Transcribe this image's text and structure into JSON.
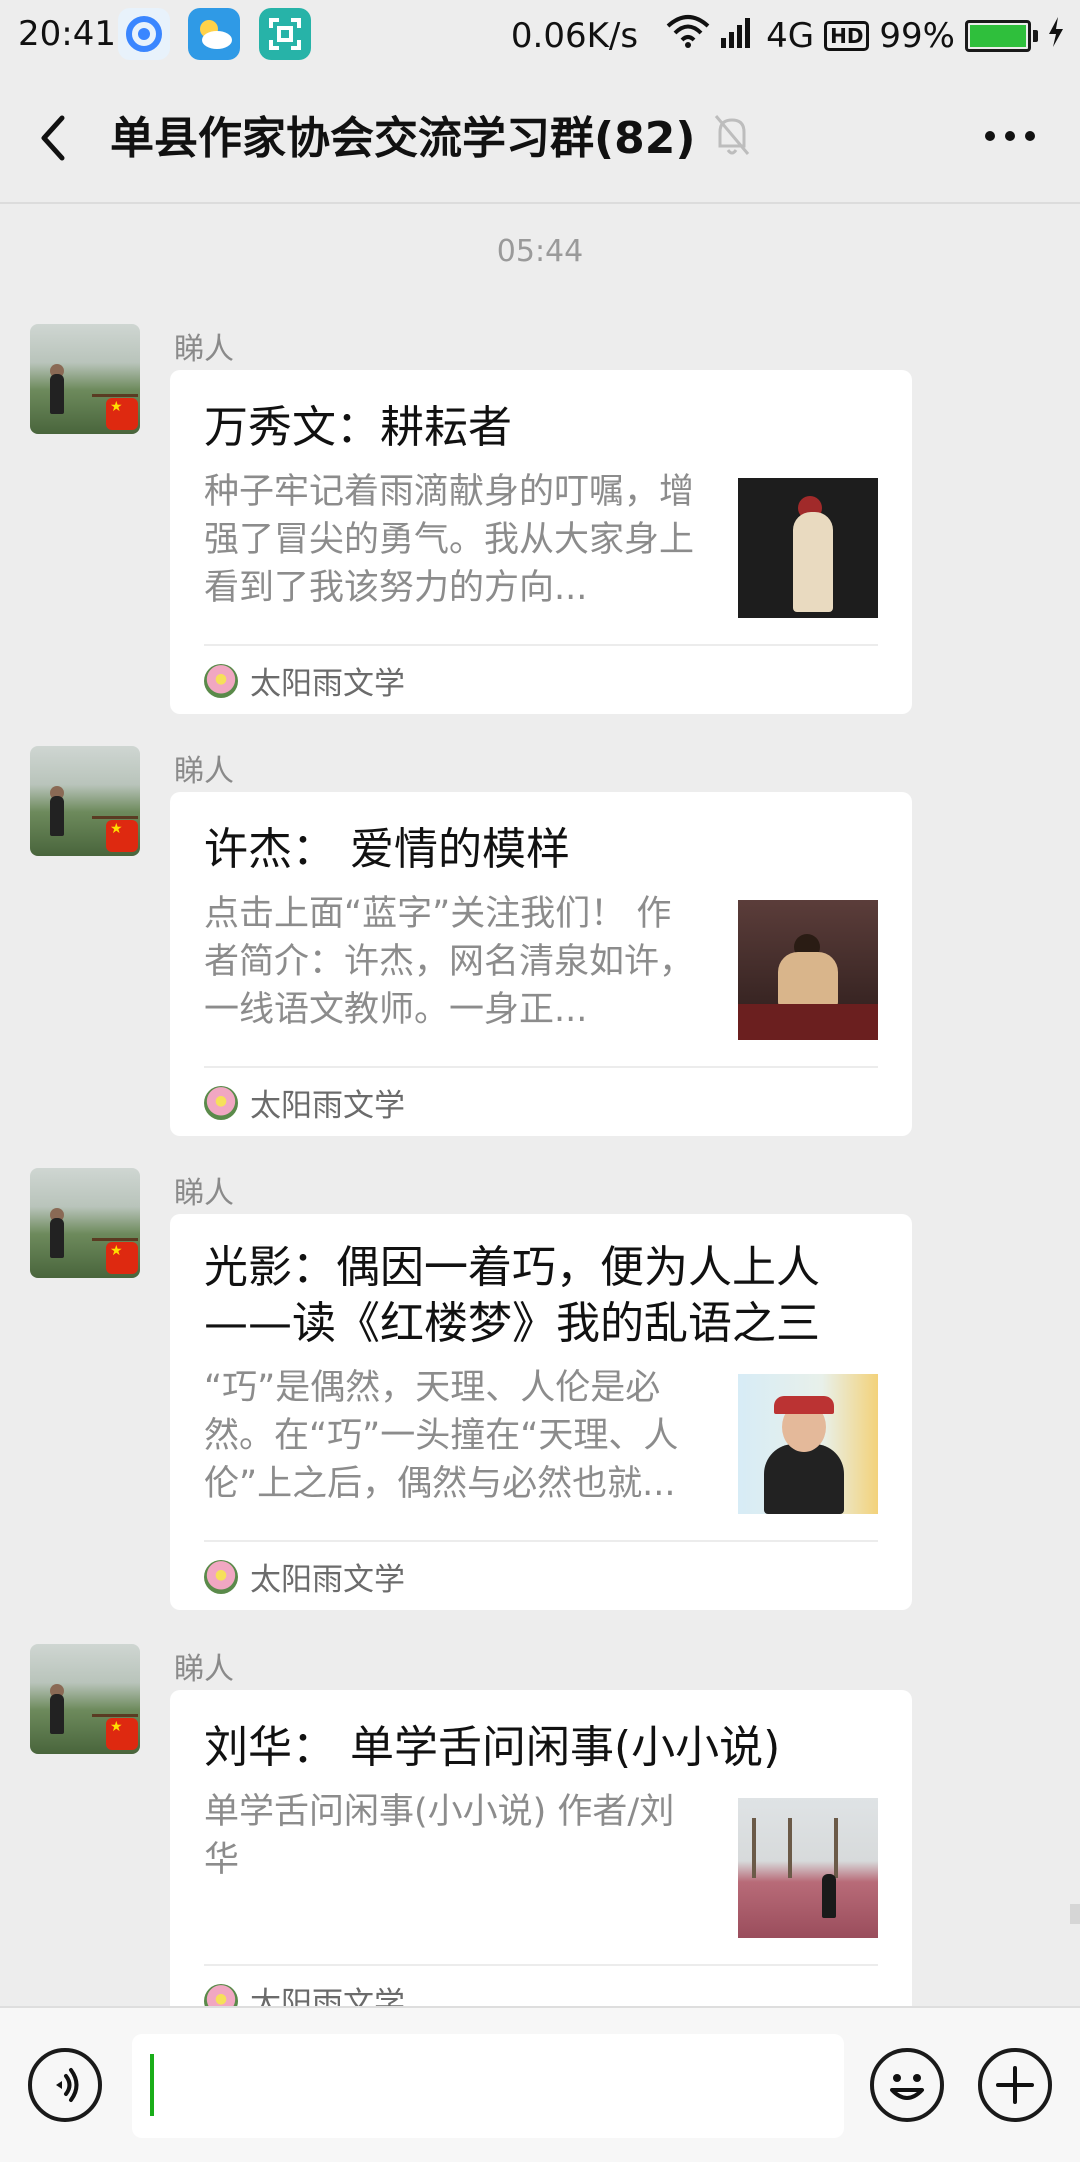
{
  "status_bar": {
    "time": "20:41",
    "net_speed": "0.06K/s",
    "network": "4G",
    "hd": "HD",
    "battery": "99%",
    "battery_level": 0.99,
    "icons": [
      "app-icon",
      "weather-icon",
      "scan-icon",
      "wifi-icon",
      "signal-icon",
      "battery-icon",
      "charging-icon"
    ]
  },
  "nav": {
    "title": "单县作家协会交流学习群(82)",
    "icons": [
      "back-icon",
      "mute-bell-icon",
      "more-icon"
    ]
  },
  "chat": {
    "time_divider": "05:44",
    "messages": [
      {
        "sender": "睇人",
        "title": "万秀文：耕耘者",
        "desc": "种子牢记着雨滴献身的叮嘱，增强了冒尖的勇气。我从大家身上看到了我该努力的方向...",
        "source": "太阳雨文学"
      },
      {
        "sender": "睇人",
        "title": "许杰： 爱情的模样",
        "desc": "点击上面“蓝字”关注我们！ 作者简介：许杰，网名清泉如许，一线语文教师。一身正...",
        "source": "太阳雨文学"
      },
      {
        "sender": "睇人",
        "title": "光影：偶因一着巧，便为人上人\n——读《红楼梦》我的乱语之三",
        "desc": "“巧”是偶然，天理、人伦是必然。在“巧”一头撞在“天理、人伦”上之后，偶然与必然也就...",
        "source": "太阳雨文学"
      },
      {
        "sender": "睇人",
        "title": "刘华： 单学舌问闲事(小小说)",
        "desc": "单学舌问闲事(小小说) 作者/刘华",
        "source": "太阳雨文学"
      }
    ]
  },
  "input_bar": {
    "placeholder": "",
    "icons": [
      "voice-icon",
      "emoji-icon",
      "plus-icon"
    ]
  }
}
